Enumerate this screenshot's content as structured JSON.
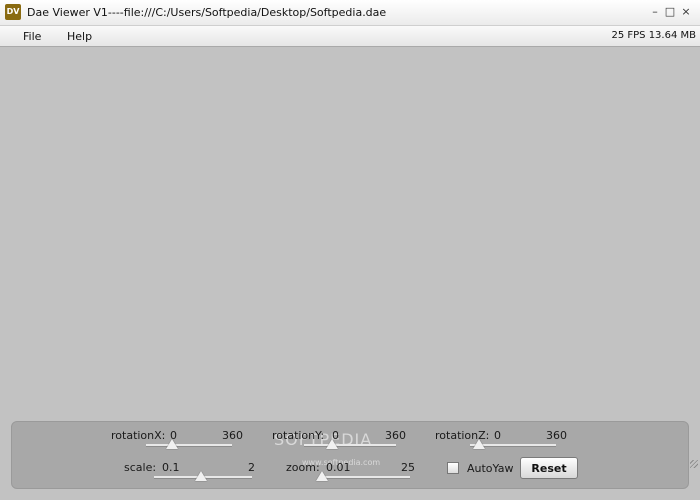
{
  "window": {
    "icon_text": "DV",
    "title": "Dae Viewer V1----file:///C:/Users/Softpedia/Desktop/Softpedia.dae",
    "controls": [
      "–",
      "□",
      "×"
    ]
  },
  "menu": {
    "items": [
      "File",
      "Help"
    ],
    "status": "25 FPS 13.64 MB"
  },
  "panel": {
    "rotationX": {
      "label": "rotationX:",
      "value": "0",
      "max": "360",
      "fraction": 0.3
    },
    "rotationY": {
      "label": "rotationY:",
      "value": "0",
      "max": "360",
      "fraction": 0.3
    },
    "rotationZ": {
      "label": "rotationZ:",
      "value": "0",
      "max": "360",
      "fraction": 0.1
    },
    "scale": {
      "label": "scale:",
      "value": "0.1",
      "max": "2",
      "fraction": 0.48
    },
    "zoom": {
      "label": "zoom:",
      "value": "0.01",
      "max": "25",
      "fraction": 0.0
    },
    "autoyaw": {
      "label": "AutoYaw",
      "checked": false
    },
    "reset_label": "Reset",
    "watermark": "SOFTPEDIA",
    "watermark_sub": "www.softpedia.com"
  }
}
